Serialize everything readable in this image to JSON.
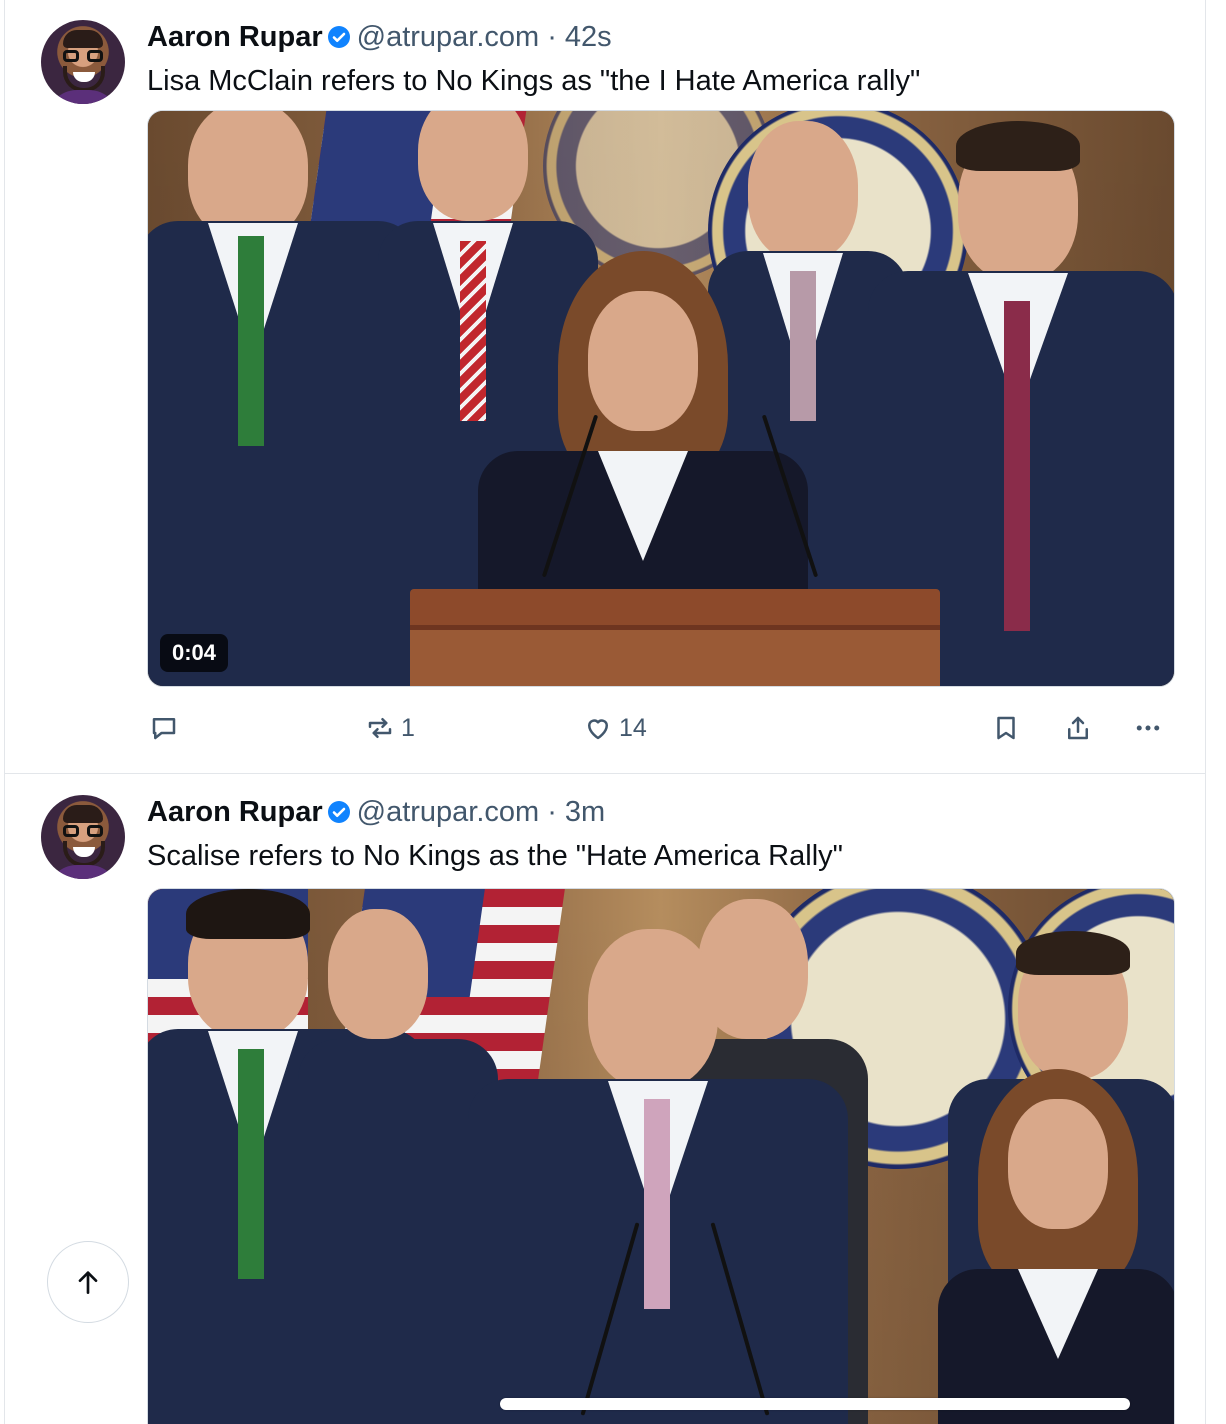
{
  "posts": [
    {
      "author": "Aaron Rupar",
      "handle": "@atrupar.com",
      "separator": "·",
      "time": "42s",
      "text": "Lisa McClain refers to No Kings as \"the I Hate America rally\"",
      "video_duration": "0:04",
      "reposts": "1",
      "likes": "14"
    },
    {
      "author": "Aaron Rupar",
      "handle": "@atrupar.com",
      "separator": "·",
      "time": "3m",
      "text": "Scalise refers to No Kings as the \"Hate America Rally\""
    }
  ],
  "icons": {
    "reply": "speech-bubble-icon",
    "repost": "repost-arrows-icon",
    "like": "heart-icon",
    "bookmark": "bookmark-icon",
    "share": "share-icon",
    "more": "ellipsis-icon",
    "verified": "verified-check-icon",
    "scroll_top": "arrow-up-icon"
  },
  "colors": {
    "verified": "#1083fe",
    "muted_text": "#42576c",
    "border": "#e3e6ea"
  }
}
